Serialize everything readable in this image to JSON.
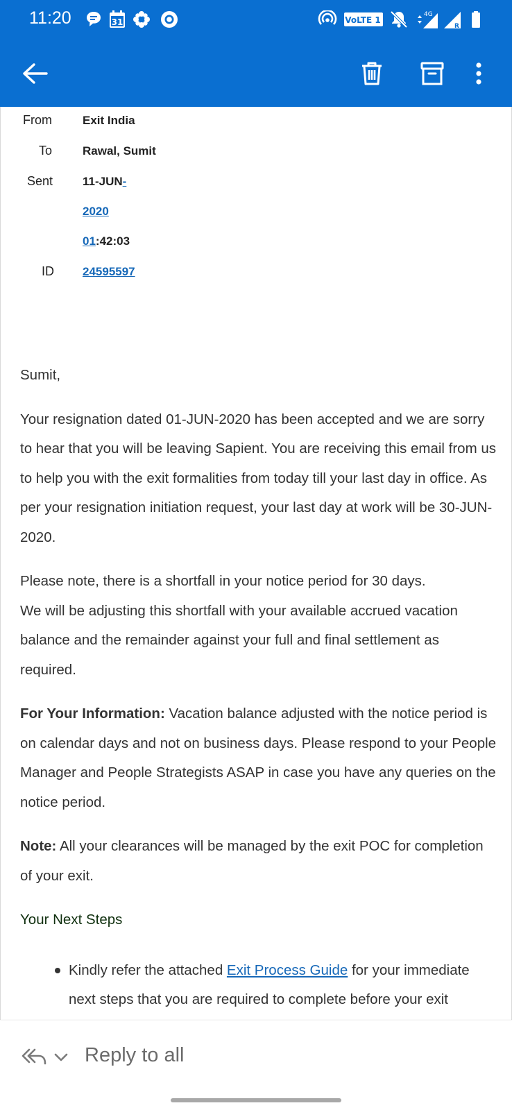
{
  "status_bar": {
    "time": "11:20",
    "left_icons": [
      "chat-notification-icon",
      "calendar-icon",
      "pinwheel-icon",
      "circle-app-icon"
    ],
    "calendar_day": "31",
    "volte_label": "VoLTE 1",
    "network_label": "4G",
    "roaming_label": "R",
    "right_icons": [
      "hotspot-icon",
      "volte-icon",
      "mute-bell-icon",
      "signal-4g-icon",
      "signal-roaming-icon",
      "battery-icon"
    ]
  },
  "app_bar": {
    "back_icon": "arrow-left-icon",
    "actions": [
      "trash-icon",
      "archive-icon",
      "more-vertical-icon"
    ],
    "accent_color": "#0a6fd1"
  },
  "header": {
    "from_label": "From",
    "from_value": "Exit India",
    "to_label": "To",
    "to_value": "Rawal, Sumit",
    "sent_label": "Sent",
    "sent_line1_a": "11-JUN",
    "sent_line1_b": "-",
    "sent_line2": "2020",
    "sent_line3_a": "01",
    "sent_line3_b": ":42:03",
    "id_label": "ID",
    "id_value": "24595597"
  },
  "body": {
    "greeting": "Sumit,",
    "para1": "Your resignation dated 01-JUN-2020 has been accepted and we are sorry to hear that you will be leaving Sapient. You are receiving this email from us to help you with the exit formalities from today till your last day in office. As per your resignation initiation request, your last day at work will be 30-JUN-2020.",
    "para2_line1": "Please note, there is a shortfall in your notice period for 30 days.",
    "para2_line2": "We will be adjusting this shortfall with your available accrued vacation balance and the remainder against your full and final settlement as required.",
    "fyi_label": "For Your Information:",
    "fyi_text": " Vacation balance adjusted with the notice period is on calendar days and not on business days. Please respond to your People Manager and People Strategists ASAP in case you have any queries on the notice period.",
    "note_label": "Note:",
    "note_text": " All your clearances will be managed by the exit POC for completion of your exit.",
    "next_steps_heading": "Your Next Steps",
    "bullet1_prefix": "Kindly refer the attached ",
    "bullet1_link": "Exit Process Guide",
    "bullet1_suffix": " for your immediate next steps that you are required to complete before your exit"
  },
  "reply_bar": {
    "reply_all_icon": "reply-all-icon",
    "dropdown_icon": "chevron-down-icon",
    "label": "Reply to all"
  }
}
